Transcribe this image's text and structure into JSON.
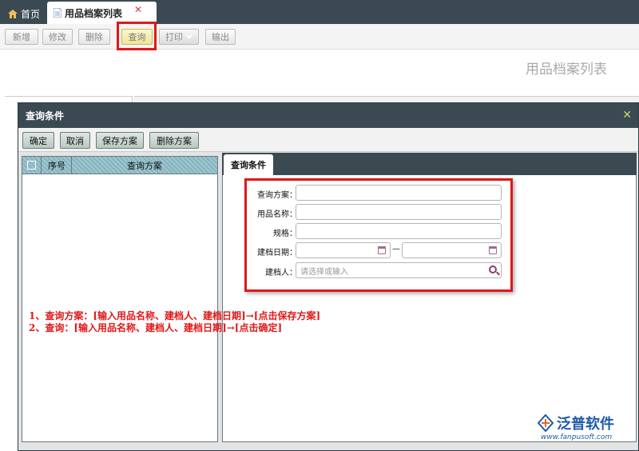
{
  "tabs": {
    "home_label": "首页",
    "active_label": "用品档案列表",
    "close_glyph": "✕"
  },
  "toolbar": {
    "add": "新增",
    "edit": "修改",
    "delete": "删除",
    "query": "查询",
    "print": "打印",
    "export": "输出"
  },
  "page": {
    "title": "用品档案列表"
  },
  "dialog": {
    "title": "查询条件",
    "close_glyph": "✕",
    "buttons": {
      "confirm": "确定",
      "cancel": "取消",
      "save_scheme": "保存方案",
      "delete_scheme": "删除方案"
    },
    "left_panel": {
      "columns": [
        "序号",
        "查询方案"
      ]
    },
    "right_panel": {
      "tab_label": "查询条件",
      "fields": {
        "scheme_label": "查询方案：",
        "name_label": "用品名称：",
        "spec_label": "规格：",
        "date_label": "建档日期：",
        "creator_label": "建档人：",
        "creator_placeholder": "请选择或输入",
        "date_separator": "—"
      }
    }
  },
  "instructions": [
    "1、查询方案：[输入用品名称、建档人、建档日期]→[点击保存方案]",
    "2、查询：[输入用品名称、建档人、建档日期]→[点击确定]"
  ],
  "logo": {
    "name": "泛普软件",
    "url": "www.fanpusoft.com"
  },
  "colors": {
    "header_dark": "#3b4a52",
    "highlight_red": "#e01818",
    "grid_header_teal": "#84b4be",
    "brand_blue": "#1e5aa8"
  }
}
